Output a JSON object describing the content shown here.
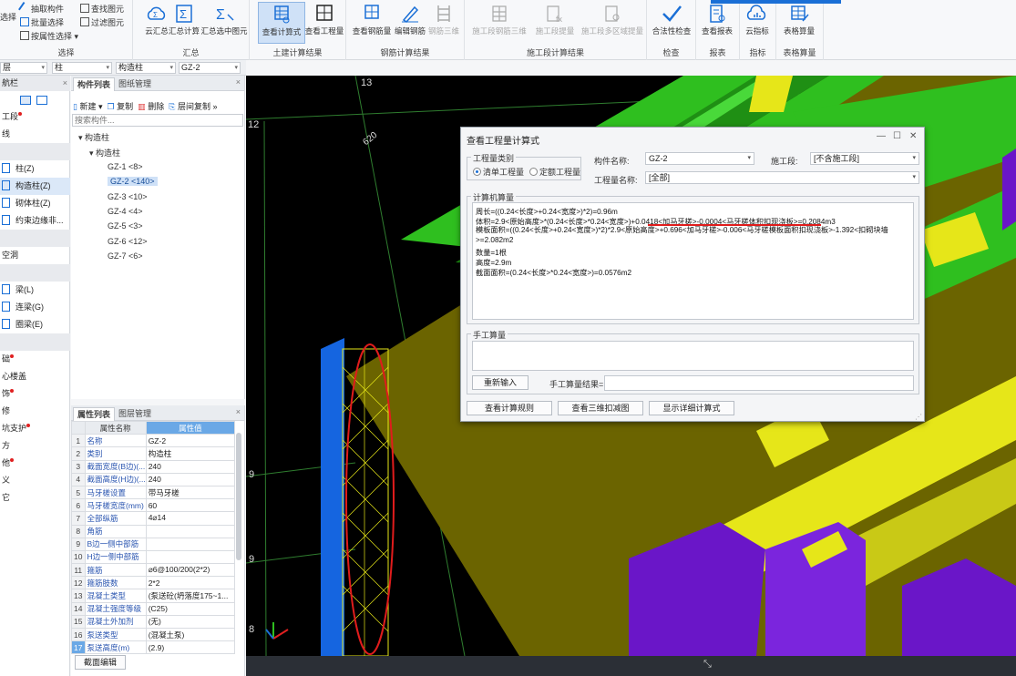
{
  "ribbon": {
    "select_group": {
      "title": "选择",
      "pick_component": "抽取构件",
      "batch_select": "批量选择",
      "select_by_floor": "按属性选择",
      "find_element": "查找图元",
      "filter_element": "过滤图元",
      "select_partial": "选择"
    },
    "summary_group": {
      "title": "汇总",
      "cloud_summary": "云汇总",
      "summary_calc": "汇总计算",
      "summary_selected": "汇总选中图元"
    },
    "civil_group": {
      "title": "土建计算结果",
      "view_formula": "查看计算式",
      "view_quantity": "查看工程量"
    },
    "rebar_group": {
      "title": "钢筋计算结果",
      "view_rebar": "查看钢筋量",
      "edit_rebar": "编辑钢筋",
      "rebar_3d": "钢筋三维"
    },
    "stage_group": {
      "title": "施工段计算结果",
      "stage_rebar_3d": "施工段钢筋三维",
      "stage_quantity": "施工段提量",
      "stage_multi_area": "施工段多区域提量"
    },
    "check_group": {
      "title": "检查",
      "legality_check": "合法性检查"
    },
    "report_group": {
      "title": "报表",
      "view_report": "查看报表"
    },
    "index_group": {
      "title": "指标",
      "cloud_index": "云指标"
    },
    "table_group": {
      "title": "表格算量",
      "table_calc": "表格算量"
    }
  },
  "filters": {
    "floor": "层",
    "category": "柱",
    "type": "构造柱",
    "component": "GZ-2"
  },
  "leftnav": {
    "title": "航栏",
    "items": [
      {
        "label": "工段",
        "dot": true
      },
      {
        "label": "线",
        "dot": false
      },
      {
        "label": "柱(Z)",
        "dot": false
      },
      {
        "label": "构造柱(Z)",
        "dot": false
      },
      {
        "label": "砌体柱(Z)",
        "dot": false
      },
      {
        "label": "约束边缘非...",
        "dot": false
      },
      {
        "label": "空洞",
        "dot": false
      },
      {
        "label": "梁(L)",
        "dot": false
      },
      {
        "label": "连梁(G)",
        "dot": false
      },
      {
        "label": "圈梁(E)",
        "dot": false
      },
      {
        "label": "础",
        "dot": true
      },
      {
        "label": "心楼盖",
        "dot": false
      },
      {
        "label": "饰",
        "dot": true
      },
      {
        "label": "修",
        "dot": false
      },
      {
        "label": "坑支护",
        "dot": true
      },
      {
        "label": "方",
        "dot": false
      },
      {
        "label": "他",
        "dot": true
      },
      {
        "label": "义",
        "dot": false
      },
      {
        "label": "它",
        "dot": false
      }
    ]
  },
  "complist": {
    "tab_list": "构件列表",
    "tab_drawing": "图纸管理",
    "new": "新建",
    "copy": "复制",
    "delete": "删除",
    "floor_copy": "层间复制",
    "search_placeholder": "搜索构件...",
    "root": "构造柱",
    "child": "构造柱",
    "items": [
      "GZ-1 <8>",
      "GZ-2 <140>",
      "GZ-3 <10>",
      "GZ-4 <4>",
      "GZ-5 <3>",
      "GZ-6 <12>",
      "GZ-7 <6>"
    ],
    "selected_index": 1
  },
  "props": {
    "tab_attr": "属性列表",
    "tab_layer": "图层管理",
    "col_name": "属性名称",
    "col_value": "属性值",
    "rows": [
      {
        "n": "1",
        "k": "名称",
        "v": "GZ-2"
      },
      {
        "n": "2",
        "k": "类别",
        "v": "构造柱"
      },
      {
        "n": "3",
        "k": "截面宽度(B边)(...",
        "v": "240"
      },
      {
        "n": "4",
        "k": "截面高度(H边)(...",
        "v": "240"
      },
      {
        "n": "5",
        "k": "马牙槎设置",
        "v": "带马牙槎"
      },
      {
        "n": "6",
        "k": "马牙槎宽度(mm)",
        "v": "60"
      },
      {
        "n": "7",
        "k": "全部纵筋",
        "v": "4⌀14"
      },
      {
        "n": "8",
        "k": "角筋",
        "v": ""
      },
      {
        "n": "9",
        "k": "B边一侧中部筋",
        "v": ""
      },
      {
        "n": "10",
        "k": "H边一侧中部筋",
        "v": ""
      },
      {
        "n": "11",
        "k": "箍筋",
        "v": "⌀6@100/200(2*2)"
      },
      {
        "n": "12",
        "k": "箍筋肢数",
        "v": "2*2"
      },
      {
        "n": "13",
        "k": "混凝土类型",
        "v": "(泵送砼(坍落度175~1..."
      },
      {
        "n": "14",
        "k": "混凝土强度等级",
        "v": "(C25)"
      },
      {
        "n": "15",
        "k": "混凝土外加剂",
        "v": "(无)"
      },
      {
        "n": "16",
        "k": "泵送类型",
        "v": "(混凝土泵)"
      },
      {
        "n": "17",
        "k": "泵送高度(m)",
        "v": "(2.9)"
      }
    ],
    "edit_button": "截面编辑"
  },
  "view3d": {
    "grid_labels": [
      "13",
      "12",
      "620",
      "9",
      "9",
      "8"
    ],
    "colors": {
      "green": "#2fbf1f",
      "olive": "#6b6400",
      "yellow": "#e6e619",
      "purple": "#6a16c8",
      "blue": "#1565e0"
    }
  },
  "dialog": {
    "title": "查看工程量计算式",
    "qty_type_legend": "工程量类别",
    "radio_list": "清单工程量",
    "radio_quota": "定额工程量",
    "comp_name_label": "构件名称:",
    "comp_name_value": "GZ-2",
    "stage_label": "施工段:",
    "stage_value": "[不含施工段]",
    "qty_name_label": "工程量名称:",
    "qty_name_value": "[全部]",
    "computer_legend": "计算机算量",
    "lines": [
      "周长=((0.24<长度>+0.24<宽度>)*2)=0.96m",
      "体积=2.9<原始高度>*(0.24<长度>*0.24<宽度>)+0.0418<加马牙槎>-0.0004<马牙槎体积扣现浇板>=0.2084m3",
      "模板面积=((0.24<长度>+0.24<宽度>)*2)*2.9<原始高度>+0.696<加马牙槎>-0.006<马牙槎模板面积扣现浇板>-1.392<扣砌块墙>=2.082m2",
      "数量=1根",
      "高度=2.9m",
      "截面面积=(0.24<长度>*0.24<宽度>)=0.0576m2"
    ],
    "manual_legend": "手工算量",
    "reinput": "重新输入",
    "manual_result_label": "手工算量结果=",
    "btn_rules": "查看计算规则",
    "btn_3d": "查看三维扣减图",
    "btn_detail": "显示详细计算式"
  }
}
